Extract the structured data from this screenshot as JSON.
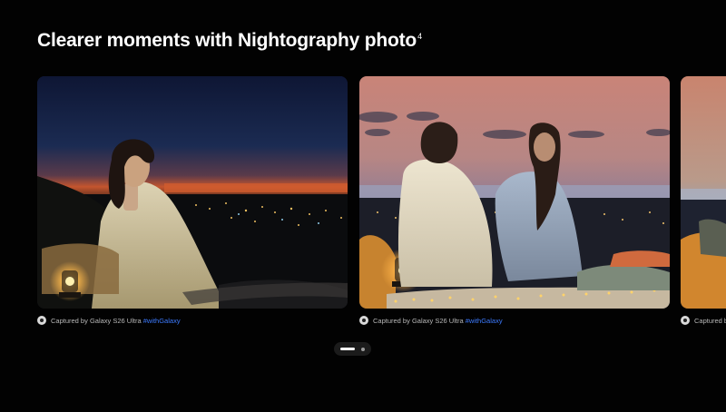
{
  "section": {
    "title": "Clearer moments with Nightography photo",
    "title_footnote": "4"
  },
  "carousel": {
    "slides": [
      {
        "image": "woman-sitting-at-dusk-overlooking-city-lights",
        "caption_prefix": "Captured by Galaxy S26 Ultra ",
        "caption_hashtag": "#withGalaxy"
      },
      {
        "image": "couple-sitting-back-view-pink-sunset-over-city",
        "caption_prefix": "Captured by Galaxy S26 Ultra ",
        "caption_hashtag": "#withGalaxy"
      },
      {
        "image": "partially-visible-third-photo",
        "caption_prefix": "Captured by",
        "caption_hashtag": ""
      }
    ],
    "active_index": 0,
    "page_count": 2
  },
  "icons": {
    "caption_icon": "camera-lens-icon"
  },
  "colors": {
    "background": "#020202",
    "hashtag": "#3d7bff",
    "caption_text": "#b8b8b8"
  }
}
